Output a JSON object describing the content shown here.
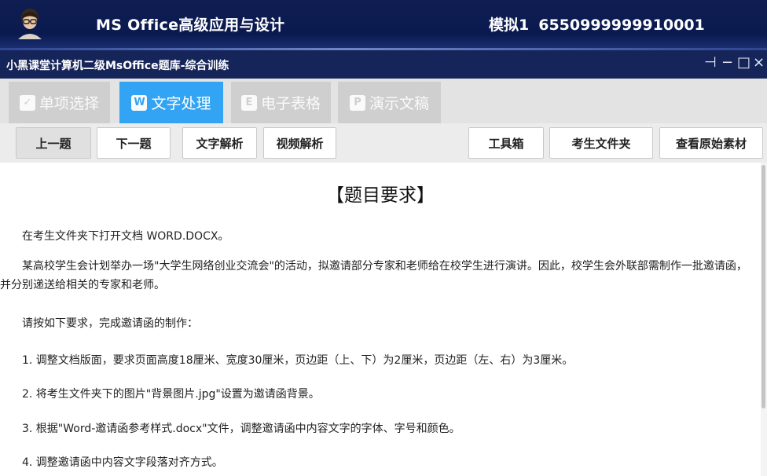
{
  "header": {
    "app_title": "MS Office高级应用与设计",
    "exam_label": "模拟1",
    "exam_number": "6550999999910001"
  },
  "window": {
    "title": "小黑课堂计算机二级MsOffice题库-综合训练",
    "pin": "⊣",
    "minimize": "−",
    "maximize": "□",
    "close": "×"
  },
  "tabs": [
    {
      "icon": "✓",
      "label": "单项选择",
      "active": false
    },
    {
      "icon": "W",
      "label": "文字处理",
      "active": true
    },
    {
      "icon": "E",
      "label": "电子表格",
      "active": false
    },
    {
      "icon": "P",
      "label": "演示文稿",
      "active": false
    }
  ],
  "toolbar": {
    "prev": "上一题",
    "next": "下一题",
    "text_analysis": "文字解析",
    "video_analysis": "视频解析",
    "toolbox": "工具箱",
    "student_folder": "考生文件夹",
    "view_original": "查看原始素材"
  },
  "content": {
    "title": "【题目要求】",
    "paragraphs": [
      "在考生文件夹下打开文档 WORD.DOCX。",
      "某高校学生会计划举办一场\"大学生网络创业交流会\"的活动，拟邀请部分专家和老师给在校学生进行演讲。因此，校学生会外联部需制作一批邀请函，并分别递送给相关的专家和老师。",
      "请按如下要求，完成邀请函的制作：",
      "1. 调整文档版面，要求页面高度18厘米、宽度30厘米，页边距（上、下）为2厘米，页边距（左、右）为3厘米。",
      "2. 将考生文件夹下的图片\"背景图片.jpg\"设置为邀请函背景。",
      "3. 根据\"Word-邀请函参考样式.docx\"文件，调整邀请函中内容文字的字体、字号和颜色。",
      "4. 调整邀请函中内容文字段落对齐方式。"
    ]
  },
  "colors": {
    "header_bg": "#0f1d52",
    "active_tab": "#32a4f3",
    "inactive_tab": "#cfcfcf"
  }
}
